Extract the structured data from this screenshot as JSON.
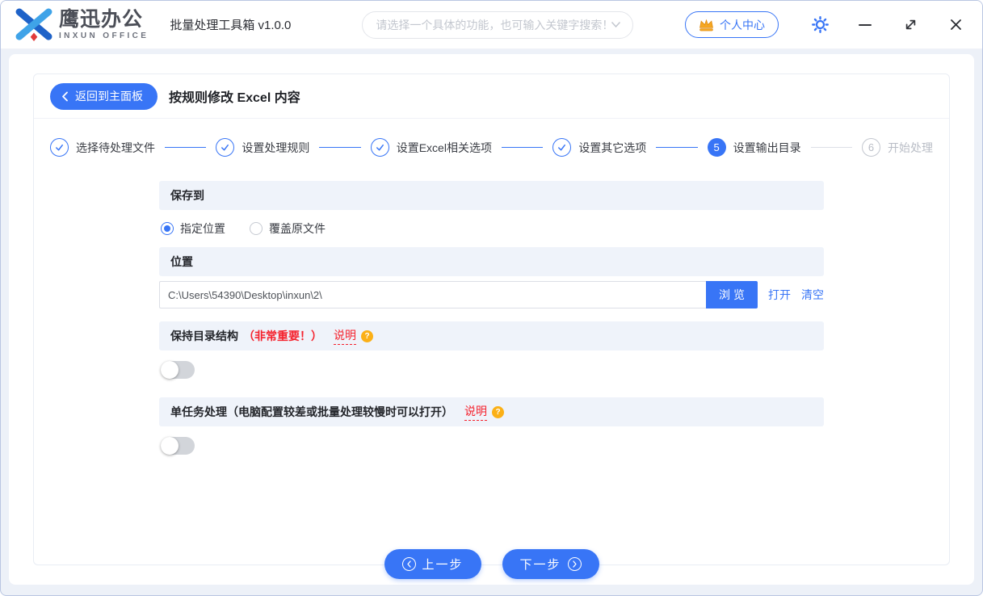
{
  "window": {
    "brand": {
      "name_cn": "鹰迅办公",
      "name_en": "INXUN OFFICE"
    },
    "app_title": "批量处理工具箱 v1.0.0",
    "search_placeholder": "请选择一个具体的功能，也可输入关键字搜索！",
    "user_center_label": "个人中心"
  },
  "page": {
    "back_label": "返回到主面板",
    "title": "按规则修改 Excel 内容"
  },
  "steps": [
    {
      "label": "选择待处理文件",
      "state": "done"
    },
    {
      "label": "设置处理规则",
      "state": "done"
    },
    {
      "label": "设置Excel相关选项",
      "state": "done"
    },
    {
      "label": "设置其它选项",
      "state": "done"
    },
    {
      "label": "设置输出目录",
      "state": "current",
      "number": "5"
    },
    {
      "label": "开始处理",
      "state": "pending",
      "number": "6"
    }
  ],
  "form": {
    "save_to": {
      "header": "保存到",
      "options": [
        {
          "label": "指定位置",
          "selected": true
        },
        {
          "label": "覆盖原文件",
          "selected": false
        }
      ]
    },
    "location": {
      "header": "位置",
      "path_value": "C:\\Users\\54390\\Desktop\\inxun\\2\\",
      "browse_label": "浏览",
      "open_label": "打开",
      "clear_label": "清空"
    },
    "keep_structure": {
      "title": "保持目录结构",
      "important_note": "（非常重要！）",
      "help_label": "说明",
      "help_badge": "?",
      "enabled": false
    },
    "single_task": {
      "title": "单任务处理（电脑配置较差或批量处理较慢时可以打开）",
      "help_label": "说明",
      "help_badge": "?",
      "enabled": false
    }
  },
  "footer": {
    "prev_label": "上一步",
    "next_label": "下一步"
  },
  "colors": {
    "primary": "#3875f6",
    "danger": "#f5222d",
    "warning": "#fbb016",
    "section_bg": "#eff3fa",
    "window_bg": "#edf1f8"
  }
}
